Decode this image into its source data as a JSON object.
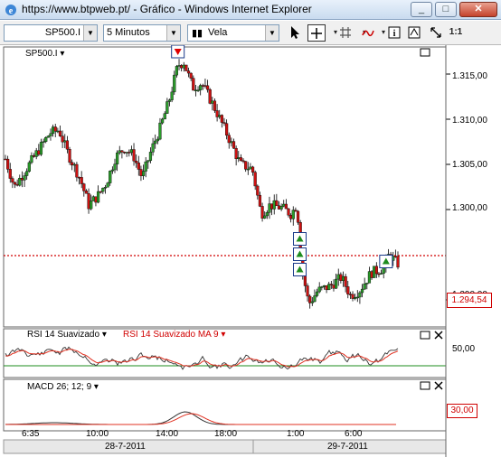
{
  "window": {
    "title": "https://www.btpweb.pt/ - Gráfico - Windows Internet Explorer",
    "buttons": {
      "minimize": "_",
      "maximize": "□",
      "close": "✕"
    }
  },
  "toolbar": {
    "symbol": "SP500.I",
    "interval": "5 Minutos",
    "chart_type": "Vela",
    "zoom_label": "1:1"
  },
  "main_panel": {
    "symbol_label": "SP500.I ▾",
    "price_ticks": [
      "1.315,00",
      "1.310,00",
      "1.305,00",
      "1.300,00",
      "1.290,00"
    ],
    "last_price": "1.294,54"
  },
  "rsi_panel": {
    "label_rsi": "RSI 14 Suavizado ▾",
    "label_ma": "RSI 14 Suavizado MA 9 ▾",
    "tick_50": "50,00",
    "level_30": "30,00"
  },
  "macd_panel": {
    "label": "MACD 26; 12; 9 ▾"
  },
  "time_axis": {
    "times": [
      "6:35",
      "10:00",
      "14:00",
      "18:00",
      "1:00",
      "6:00"
    ],
    "dates": [
      "28-7-2011",
      "29-7-2011"
    ]
  },
  "colors": {
    "bull": "#2b9b2b",
    "bear": "#cc1111",
    "price_line": "#d00000",
    "rsi_line": "#333333",
    "rsi_ma": "#e03020",
    "level_line": "#1e8c1e"
  },
  "chart_data": {
    "type": "candlestick",
    "symbol": "SP500.I",
    "interval": "5 Minutos",
    "y_range": [
      1287,
      1318
    ],
    "y_ticks": [
      1315,
      1310,
      1305,
      1300,
      1290
    ],
    "last": 1294.54,
    "close_path": [
      [
        0,
        1305.6
      ],
      [
        6,
        1302.5
      ],
      [
        14,
        1304.5
      ],
      [
        22,
        1306.5
      ],
      [
        30,
        1308.5
      ],
      [
        36,
        1308.8
      ],
      [
        42,
        1306.2
      ],
      [
        50,
        1303.5
      ],
      [
        56,
        1300.5
      ],
      [
        62,
        1301.5
      ],
      [
        68,
        1303.0
      ],
      [
        74,
        1305.8
      ],
      [
        80,
        1306.8
      ],
      [
        86,
        1306.0
      ],
      [
        92,
        1303.5
      ],
      [
        98,
        1306.5
      ],
      [
        104,
        1309.0
      ],
      [
        110,
        1312.0
      ],
      [
        116,
        1316.0
      ],
      [
        120,
        1316.3
      ],
      [
        126,
        1313.5
      ],
      [
        132,
        1314.0
      ],
      [
        140,
        1311.5
      ],
      [
        150,
        1308.0
      ],
      [
        158,
        1305.0
      ],
      [
        166,
        1304.5
      ],
      [
        172,
        1299.5
      ],
      [
        178,
        1300.5
      ],
      [
        186,
        1300.2
      ],
      [
        192,
        1299.5
      ],
      [
        196,
        1300.5
      ],
      [
        200,
        1293.0
      ],
      [
        204,
        1289.5
      ],
      [
        210,
        1291.0
      ],
      [
        218,
        1291.5
      ],
      [
        226,
        1292.5
      ],
      [
        232,
        1290.5
      ],
      [
        238,
        1291.0
      ],
      [
        246,
        1293.0
      ],
      [
        254,
        1293.5
      ],
      [
        258,
        1295.0
      ],
      [
        264,
        1294.0
      ]
    ],
    "signals": [
      {
        "type": "sell",
        "t": 116
      },
      {
        "type": "buy",
        "t": 198
      },
      {
        "type": "buy",
        "t": 198
      },
      {
        "type": "buy",
        "t": 198
      },
      {
        "type": "buy",
        "t": 256
      }
    ]
  }
}
